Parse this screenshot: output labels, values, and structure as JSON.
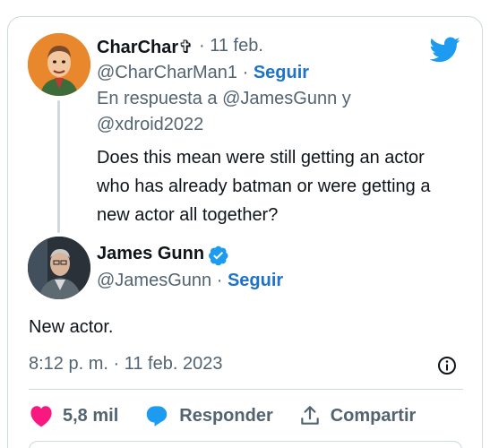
{
  "parent_tweet": {
    "name": "CharChar✞",
    "time": "· 11 feb.",
    "handle": "@CharCharMan1",
    "follow_sep": "·",
    "follow_label": "Seguir",
    "reply_prefix": "En respuesta a",
    "reply_user1": "@JamesGunn",
    "reply_joiner": "y",
    "reply_user2": "@xdroid2022",
    "text_line1": "Does this mean were still getting an actor",
    "text_line2": "who has already batman or were getting a",
    "text_line3": "new actor all together?"
  },
  "main_tweet": {
    "name": "James Gunn",
    "handle": "@JamesGunn",
    "follow_sep": "·",
    "follow_label": "Seguir",
    "text": "New actor.",
    "timestamp": "8:12 p. m. · 11 feb. 2023"
  },
  "actions": {
    "likes": "5,8 mil",
    "reply": "Responder",
    "share": "Compartir"
  },
  "colors": {
    "accent": "#1d9bf0",
    "like": "#f91880",
    "verified": "#1d9bf0"
  }
}
